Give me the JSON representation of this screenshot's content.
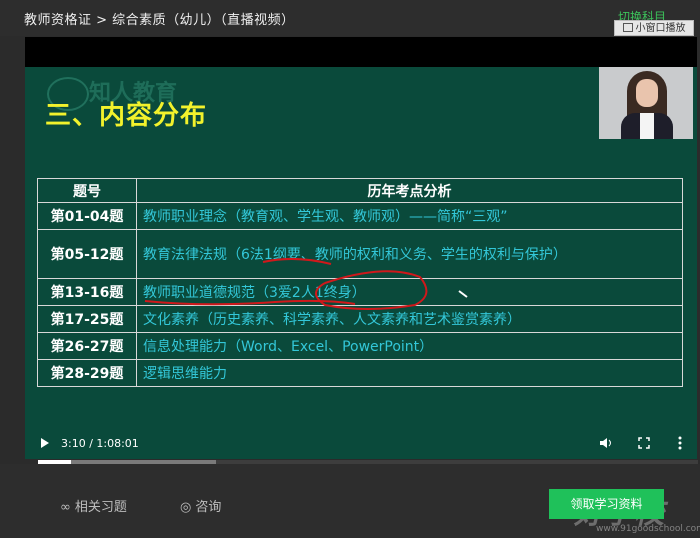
{
  "header": {
    "breadcrumb": "教师资格证 > 综合素质（幼儿）（直播视频）",
    "switch_course": "切换科目",
    "mini_window": "小窗口播放"
  },
  "slide": {
    "watermark": "知人教育",
    "title": "三、内容分布",
    "table": {
      "col_num": "题号",
      "col_analysis": "历年考点分析",
      "rows": [
        {
          "num": "第01-04题",
          "text": "教师职业理念（教育观、学生观、教师观）——简称“三观”"
        },
        {
          "num": "第05-12题",
          "text": "教育法律法规（6法1纲要、教师的权利和义务、学生的权利与保护）"
        },
        {
          "num": "第13-16题",
          "text": "教师职业道德规范（3爱2人1终身）"
        },
        {
          "num": "第17-25题",
          "text": "文化素养（历史素养、科学素养、人文素养和艺术鉴赏素养）"
        },
        {
          "num": "第26-27题",
          "text": "信息处理能力（Word、Excel、PowerPoint）"
        },
        {
          "num": "第28-29题",
          "text": "逻辑思维能力"
        }
      ]
    }
  },
  "player": {
    "time": "3:10 / 1:08:01",
    "progress_played": 0.05,
    "progress_buffered": 0.27
  },
  "bottom": {
    "exercises": "相关习题",
    "consult": "咨询",
    "get_materials": "领取学习资料",
    "logo_text": "好学校",
    "logo_url": "www.91goodschool.com"
  },
  "colors": {
    "accent": "#1fc15a",
    "slide_bg": "#0a4a3b",
    "title": "#f2f22c",
    "cyan_text": "#33c7d8"
  }
}
